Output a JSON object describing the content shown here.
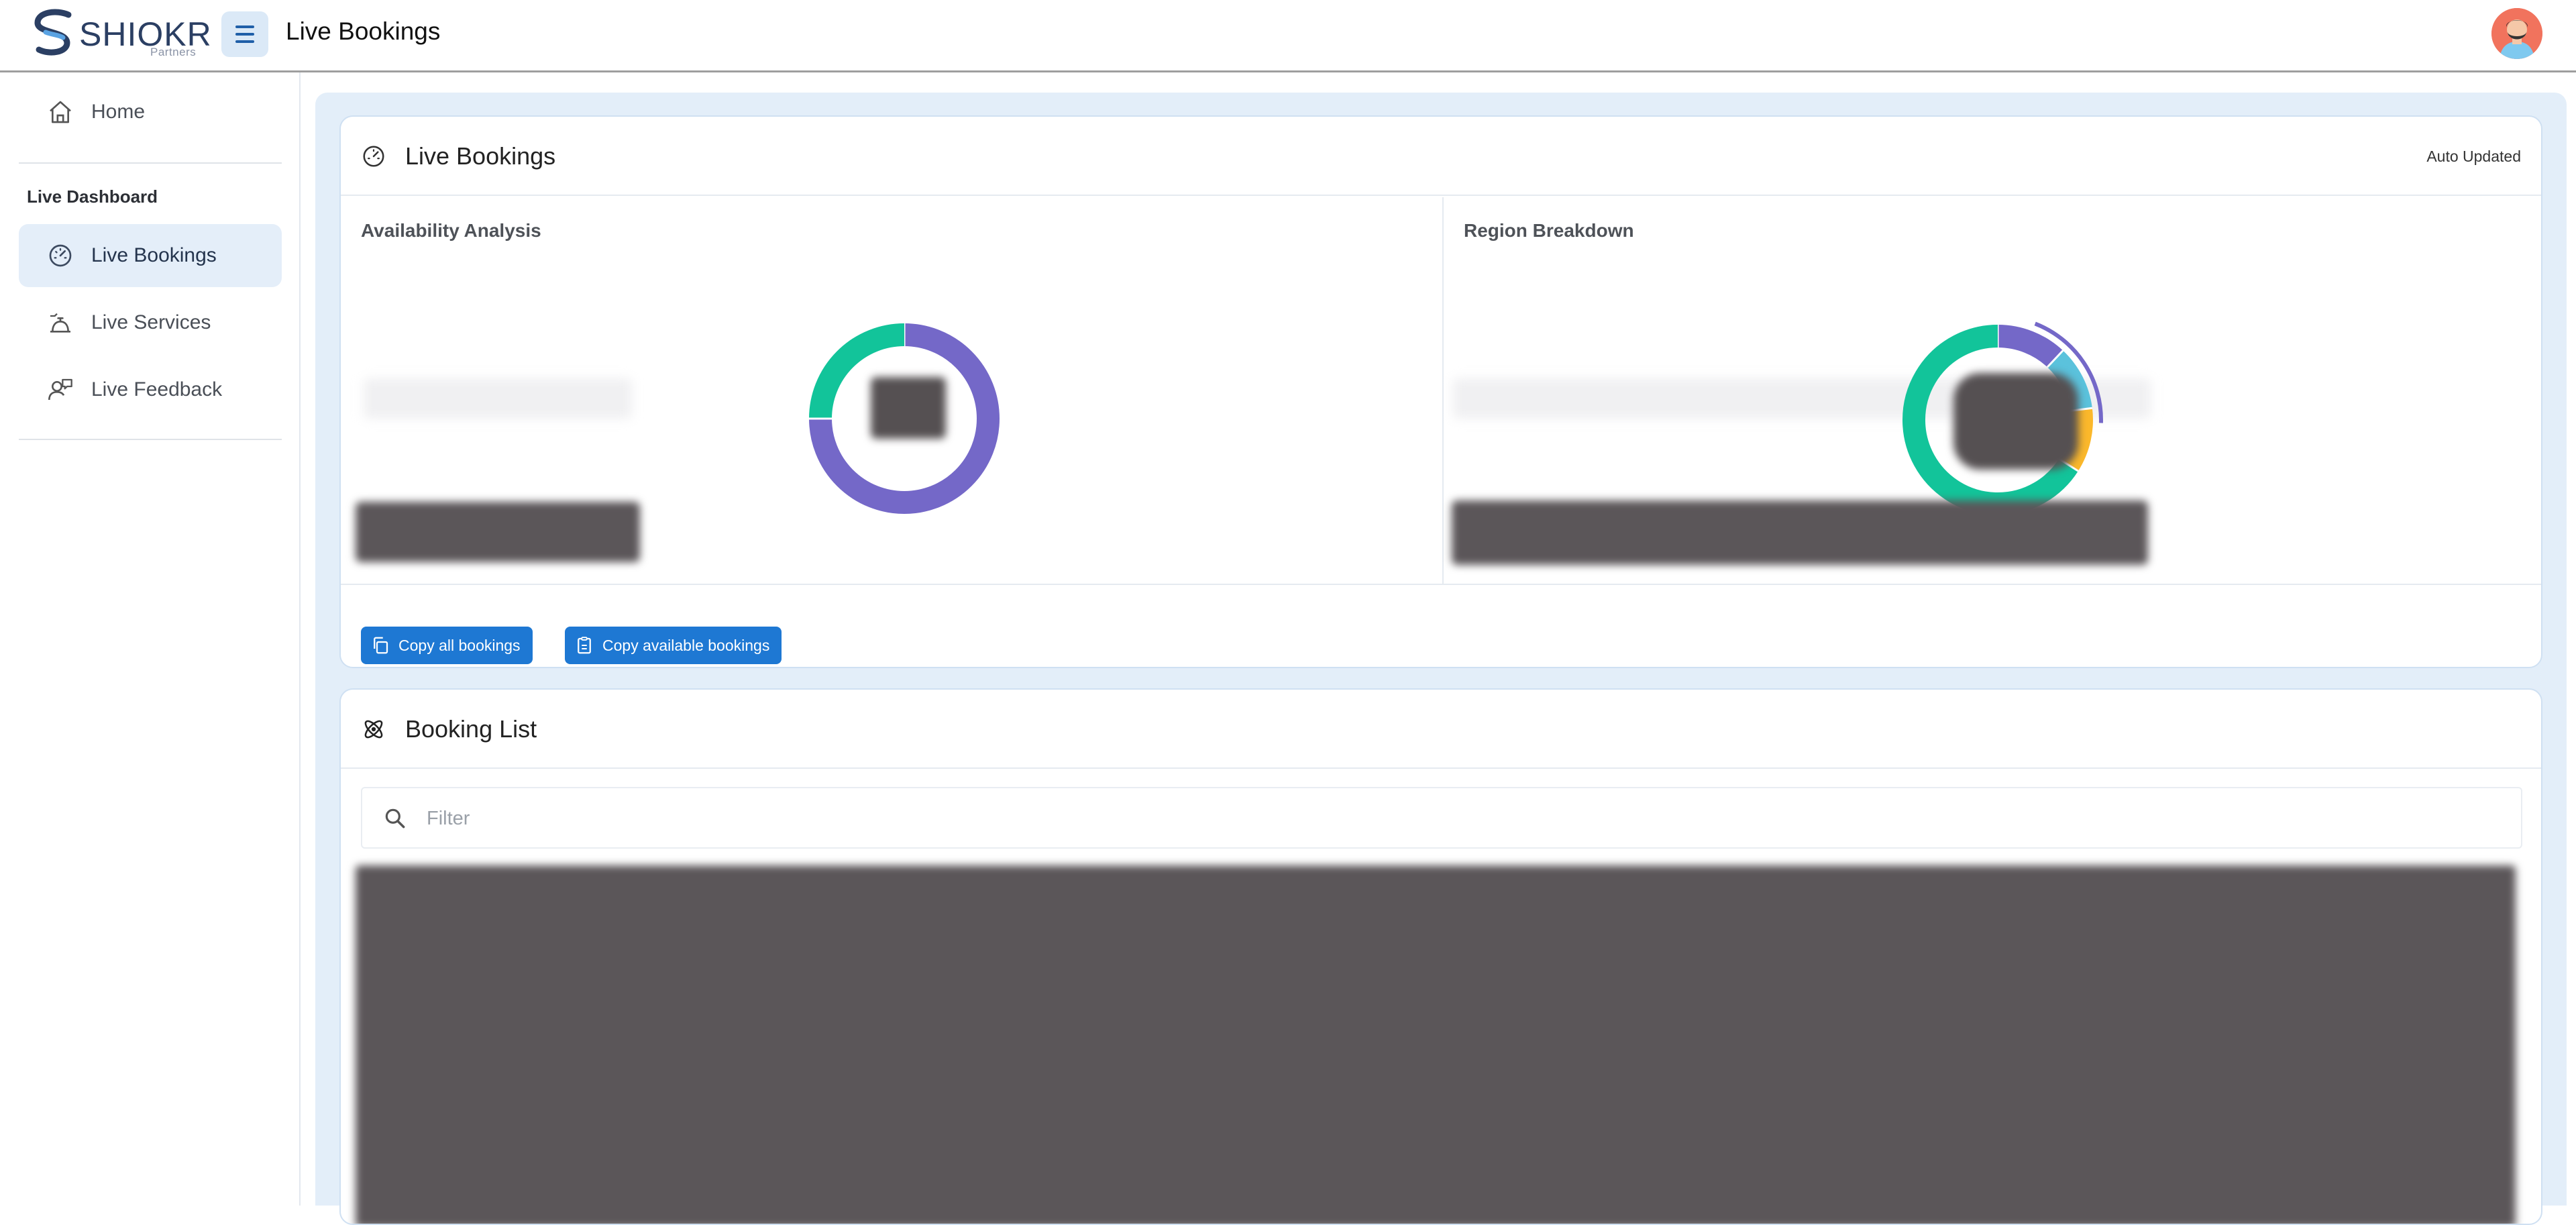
{
  "brand": {
    "name": "SHIOKR",
    "sub": "Partners"
  },
  "topbar": {
    "title": "Live Bookings"
  },
  "sidebar": {
    "home_label": "Home",
    "section_heading": "Live Dashboard",
    "items": [
      {
        "label": "Live Bookings",
        "icon": "speedometer-icon",
        "active": true
      },
      {
        "label": "Live Services",
        "icon": "service-bell-icon",
        "active": false
      },
      {
        "label": "Live Feedback",
        "icon": "user-feedback-icon",
        "active": false
      }
    ]
  },
  "live_bookings_card": {
    "title": "Live Bookings",
    "status": "Auto Updated",
    "availability_title": "Availability Analysis",
    "region_title": "Region Breakdown",
    "buttons": {
      "copy_all": "Copy all bookings",
      "copy_available": "Copy available bookings"
    }
  },
  "booking_list_card": {
    "title": "Booking List",
    "filter_placeholder": "Filter"
  },
  "colors": {
    "accent": "#1e78d3",
    "purple": "#7468c8",
    "teal": "#12c49a",
    "amber": "#fbb82b",
    "sky": "#5bc2dc"
  },
  "chart_data": [
    {
      "type": "pie",
      "title": "Availability Analysis",
      "categories": [
        "Series A",
        "Series B"
      ],
      "values": [
        75,
        25
      ],
      "colors": [
        "#7468c8",
        "#12c49a"
      ]
    },
    {
      "type": "pie",
      "title": "Region Breakdown",
      "categories": [
        "Series A",
        "Series B",
        "Series C",
        "Series D"
      ],
      "values": [
        12,
        11,
        11,
        66
      ],
      "colors": [
        "#7468c8",
        "#5bc2dc",
        "#fbb82b",
        "#12c49a"
      ]
    }
  ]
}
